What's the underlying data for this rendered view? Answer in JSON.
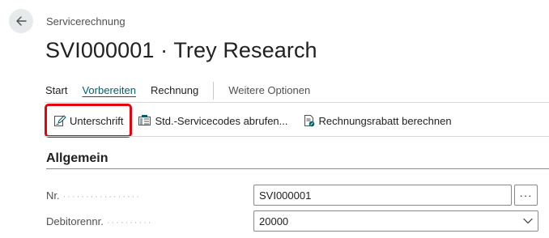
{
  "header": {
    "caption": "Servicerechnung",
    "title": "SVI000001 · Trey Research"
  },
  "action_tabs": [
    {
      "label": "Start"
    },
    {
      "label": "Vorbereiten",
      "active": true
    },
    {
      "label": "Rechnung"
    },
    {
      "label": "Weitere Optionen"
    }
  ],
  "ribbon": [
    {
      "label": "Unterschrift",
      "icon": "signature-icon",
      "highlighted": true
    },
    {
      "label": "Std.-Servicecodes abrufen...",
      "icon": "service-codes-icon"
    },
    {
      "label": "Rechnungsrabatt berechnen",
      "icon": "invoice-discount-icon"
    }
  ],
  "section": {
    "title": "Allgemein"
  },
  "fields": {
    "nr": {
      "label": "Nr.",
      "value": "SVI000001",
      "assist": "···"
    },
    "debitor": {
      "label": "Debitorennr.",
      "value": "20000"
    }
  },
  "colors": {
    "accent": "#00606e",
    "highlight": "#e8000b"
  }
}
